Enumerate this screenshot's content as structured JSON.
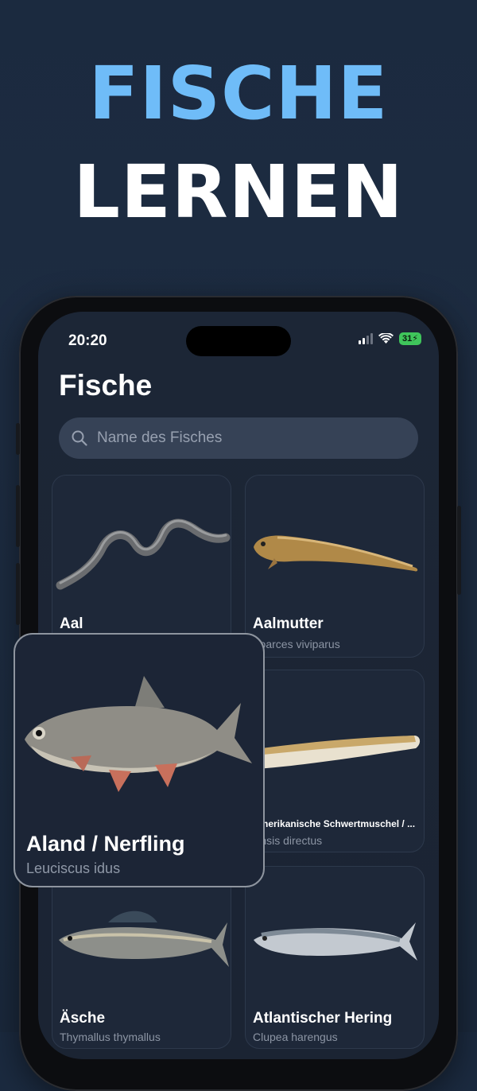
{
  "headline": {
    "line1": "FISCHE",
    "line2": "LERNEN"
  },
  "status_bar": {
    "time": "20:20",
    "battery": "31"
  },
  "screen": {
    "title": "Fische",
    "search": {
      "placeholder": "Name des Fisches",
      "value": ""
    }
  },
  "fish": [
    {
      "name": "Aal",
      "scientific": ""
    },
    {
      "name": "Aalmutter",
      "scientific": "Zoarces viviparus"
    },
    {
      "name": "Amerikanische Schwertmuschel / ...",
      "scientific": "Ensis directus"
    },
    {
      "name": "Äsche",
      "scientific": "Thymallus thymallus"
    },
    {
      "name": "Atlantischer Hering",
      "scientific": "Clupea harengus"
    }
  ],
  "featured": {
    "name": "Aland / Nerfling",
    "scientific": "Leuciscus idus"
  },
  "icons": {
    "search": "search-icon",
    "wifi": "wifi-icon",
    "signal": "signal-icon",
    "battery": "battery-icon"
  },
  "colors": {
    "accent": "#6fbcf8",
    "background": "#1b2a3f",
    "battery": "#3fc55b"
  }
}
